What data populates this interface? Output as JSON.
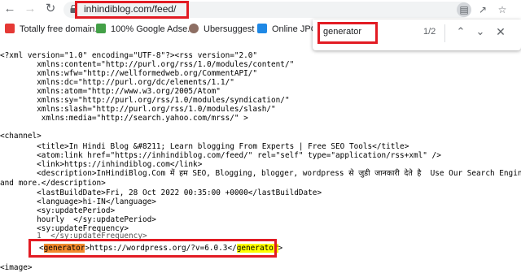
{
  "toolbar": {
    "back_icon": "arrow-left-icon",
    "forward_icon": "arrow-right-icon",
    "reload_icon": "reload-icon",
    "url": "inhindiblog.com/feed/"
  },
  "bookmarks": [
    {
      "label": "Totally free domain...",
      "icon_color": "#e53935"
    },
    {
      "label": "100% Google Adse...",
      "icon_color": "#43a047"
    },
    {
      "label": "Ubersuggest",
      "icon_color": "#8d6e63"
    },
    {
      "label": "Online JPG to",
      "icon_color": "#1e88e5"
    }
  ],
  "find": {
    "query": "generator",
    "count": "1/2"
  },
  "xml_lines": [
    "<?xml version=\"1.0\" encoding=\"UTF-8\"?><rss version=\"2.0\"",
    "        xmlns:content=\"http://purl.org/rss/1.0/modules/content/\"",
    "        xmlns:wfw=\"http://wellformedweb.org/CommentAPI/\"",
    "        xmlns:dc=\"http://purl.org/dc/elements/1.1/\"",
    "        xmlns:atom=\"http://www.w3.org/2005/Atom\"",
    "        xmlns:sy=\"http://purl.org/rss/1.0/modules/syndication/\"",
    "        xmlns:slash=\"http://purl.org/rss/1.0/modules/slash/\"",
    "         xmlns:media=\"http://search.yahoo.com/mrss/\" >",
    "",
    "<channel>",
    "        <title>In Hindi Blog &#8211; Learn blogging From Experts | Free SEO Tools</title>",
    "        <atom:link href=\"https://inhindiblog.com/feed/\" rel=\"self\" type=\"application/rss+xml\" />",
    "        <link>https://inhindiblog.com</link>",
    "        <description>InHindiBlog.Com में हम SEO, Blogging, blogger, wordpress से जुडी जानकारी देते है  Use Our Search Engine",
    "and more.</description>",
    "        <lastBuildDate>Fri, 28 Oct 2022 00:35:00 +0000</lastBuildDate>",
    "        <language>hi-IN</language>",
    "        <sy:updatePeriod>",
    "        hourly  </sy:updatePeriod>",
    "        <sy:updateFrequency>",
    "        1  </sy:updateFrequency>"
  ],
  "generator_line": {
    "open_bracket": "<",
    "tag": "generator",
    "mid": ">https://wordpress.org/?v=6.0.3</",
    "close_tag": "generator",
    "end": ">"
  },
  "last_line": "<image>",
  "colors": {
    "highlight_border": "#e21b23",
    "active_match": "#f28a2e",
    "match": "#ffff00"
  }
}
